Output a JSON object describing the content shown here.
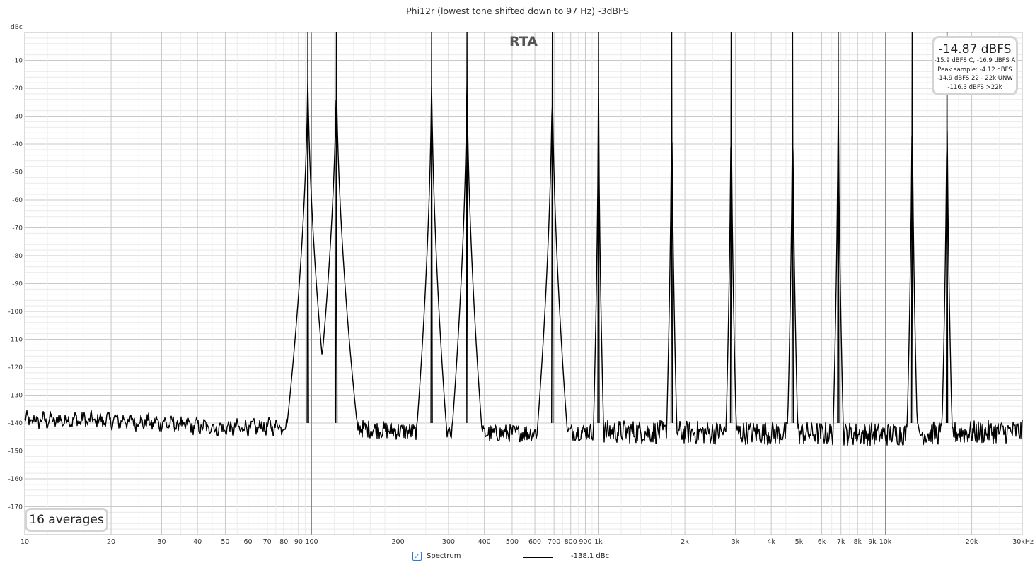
{
  "chart_data": {
    "type": "line",
    "title": "Phi12r (lowest tone shifted down to 97 Hz) -3dBFS",
    "overlay_label": "RTA",
    "ylabel": "dBc",
    "xlabel": "",
    "x_scale": "log",
    "xlim": [
      10,
      30000
    ],
    "ylim": [
      -180,
      0
    ],
    "grid": true,
    "y_ticks": [
      "-10",
      "-20",
      "-30",
      "-40",
      "-50",
      "-60",
      "-70",
      "-80",
      "-90",
      "-100",
      "-110",
      "-120",
      "-130",
      "-140",
      "-150",
      "-160",
      "-170"
    ],
    "x_ticks": [
      {
        "value": 10,
        "label": "10"
      },
      {
        "value": 20,
        "label": "20"
      },
      {
        "value": 30,
        "label": "30"
      },
      {
        "value": 40,
        "label": "40"
      },
      {
        "value": 50,
        "label": "50"
      },
      {
        "value": 60,
        "label": "60"
      },
      {
        "value": 70,
        "label": "70"
      },
      {
        "value": 80,
        "label": "80"
      },
      {
        "value": 90,
        "label": "90"
      },
      {
        "value": 100,
        "label": "100"
      },
      {
        "value": 200,
        "label": "200"
      },
      {
        "value": 300,
        "label": "300"
      },
      {
        "value": 400,
        "label": "400"
      },
      {
        "value": 500,
        "label": "500"
      },
      {
        "value": 600,
        "label": "600"
      },
      {
        "value": 700,
        "label": "700"
      },
      {
        "value": 800,
        "label": "800"
      },
      {
        "value": 900,
        "label": "900"
      },
      {
        "value": 1000,
        "label": "1k"
      },
      {
        "value": 2000,
        "label": "2k"
      },
      {
        "value": 3000,
        "label": "3k"
      },
      {
        "value": 4000,
        "label": "4k"
      },
      {
        "value": 5000,
        "label": "5k"
      },
      {
        "value": 6000,
        "label": "6k"
      },
      {
        "value": 7000,
        "label": "7k"
      },
      {
        "value": 8000,
        "label": "8k"
      },
      {
        "value": 9000,
        "label": "9k"
      },
      {
        "value": 10000,
        "label": "10k"
      },
      {
        "value": 20000,
        "label": "20k"
      },
      {
        "value": 30000,
        "label": "30kHz"
      }
    ],
    "tones_hz": [
      97,
      122,
      262,
      348,
      690,
      1000,
      1800,
      2900,
      4750,
      6850,
      12400,
      16400
    ],
    "series": [
      {
        "name": "Spectrum",
        "color": "#000000",
        "noise_floor_points": [
          {
            "x": 10,
            "y": -139
          },
          {
            "x": 20,
            "y": -139
          },
          {
            "x": 30,
            "y": -140
          },
          {
            "x": 50,
            "y": -142
          },
          {
            "x": 80,
            "y": -141
          },
          {
            "x": 90,
            "y": -136
          },
          {
            "x": 110,
            "y": -136
          },
          {
            "x": 150,
            "y": -142
          },
          {
            "x": 300,
            "y": -144
          },
          {
            "x": 1000,
            "y": -143
          },
          {
            "x": 10000,
            "y": -144
          },
          {
            "x": 30000,
            "y": -143
          }
        ]
      }
    ],
    "legend": {
      "label": "Spectrum",
      "value": "-138.1 dBc",
      "checked": true
    }
  },
  "level_readout": {
    "main": "-14.87 dBFS",
    "lines": [
      "-15.9 dBFS C, -16.9 dBFS A",
      "Peak sample: -4.12 dBFS",
      "-14.9 dBFS 22 - 22k UNW",
      "-116.3 dBFS >22k"
    ]
  },
  "averages_label": "16 averages"
}
